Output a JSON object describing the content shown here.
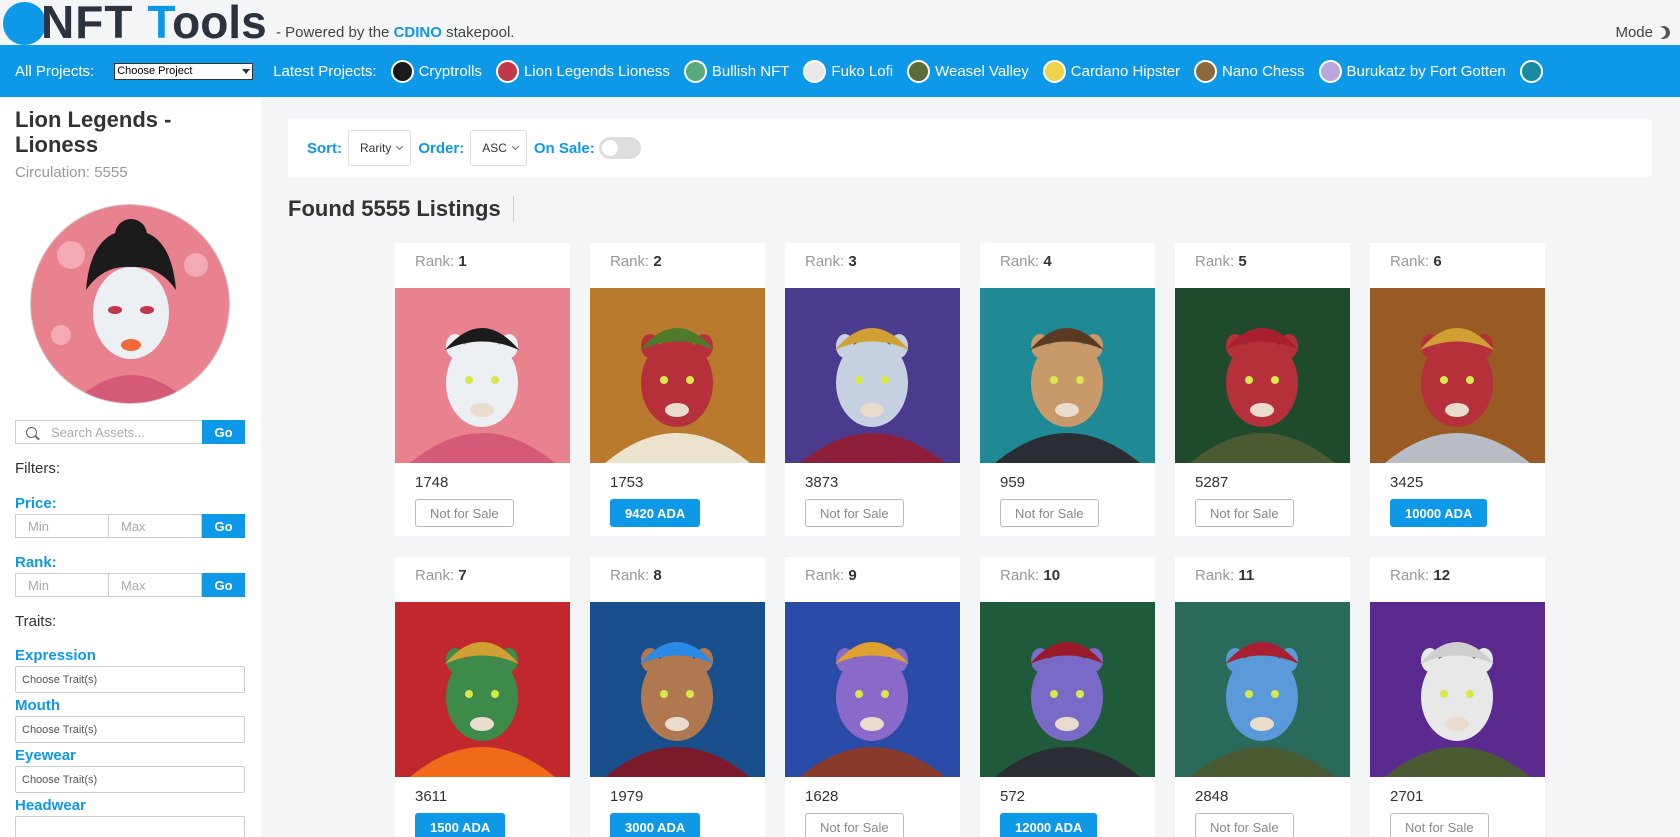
{
  "header": {
    "logo_nft": "NFT",
    "logo_tools_1": "T",
    "logo_tools_2": "ools",
    "powered_prefix": "- Powered by the",
    "powered_brand": "CDINO",
    "powered_suffix": "stakepool.",
    "mode_label": "Mode",
    "brand_color": "#0d98e8"
  },
  "projbar": {
    "all_projects_label": "All Projects:",
    "select_value": "Choose Project",
    "latest_label": "Latest Projects:",
    "projects": [
      {
        "name": "Cryptrolls",
        "color": "#1a1a1a"
      },
      {
        "name": "Lion Legends Lioness",
        "color": "#c0384a"
      },
      {
        "name": "Bullish NFT",
        "color": "#5aa97a"
      },
      {
        "name": "Fuko Lofi",
        "color": "#e8e8e8"
      },
      {
        "name": "Weasel Valley",
        "color": "#5c6b3a"
      },
      {
        "name": "Cardano Hipster",
        "color": "#f0d34a"
      },
      {
        "name": "Nano Chess",
        "color": "#8a6a3a"
      },
      {
        "name": "Burukatz by Fort Gotten",
        "color": "#b8a6e0"
      }
    ]
  },
  "sidebar": {
    "title": "Lion Legends - Lioness",
    "circulation": "Circulation: 5555",
    "search_placeholder": "Search Assets...",
    "go": "Go",
    "filters_label": "Filters:",
    "price_label": "Price:",
    "rank_label": "Rank:",
    "min": "Min",
    "max": "Max",
    "traits_label": "Traits:",
    "traits": [
      {
        "name": "Expression",
        "placeholder": "Choose Trait(s)"
      },
      {
        "name": "Mouth",
        "placeholder": "Choose Trait(s)"
      },
      {
        "name": "Eyewear",
        "placeholder": "Choose Trait(s)"
      },
      {
        "name": "Headwear",
        "placeholder": ""
      }
    ]
  },
  "filterbar": {
    "sort_label": "Sort:",
    "sort_value": "Rarity",
    "order_label": "Order:",
    "order_value": "ASC",
    "onsale_label": "On Sale:"
  },
  "found": "Found 5555 Listings",
  "cards": [
    {
      "rank_label": "Rank:",
      "rank": "1",
      "id": "1748",
      "price": "Not for Sale",
      "on_sale": false,
      "bg": "#e9828f",
      "skin": "#eceff3",
      "hat": "#1b1b1b",
      "cloth": "#d45a78"
    },
    {
      "rank_label": "Rank:",
      "rank": "2",
      "id": "1753",
      "price": "9420 ADA",
      "on_sale": true,
      "bg": "#b97a2d",
      "skin": "#b5303a",
      "hat": "#4f7a2a",
      "cloth": "#ece3cf"
    },
    {
      "rank_label": "Rank:",
      "rank": "3",
      "id": "3873",
      "price": "Not for Sale",
      "on_sale": false,
      "bg": "#4a3b8e",
      "skin": "#c5d0e0",
      "hat": "#d1a032",
      "cloth": "#8e1f3a"
    },
    {
      "rank_label": "Rank:",
      "rank": "4",
      "id": "959",
      "price": "Not for Sale",
      "on_sale": false,
      "bg": "#1f8a95",
      "skin": "#c89a6a",
      "hat": "#5a3a22",
      "cloth": "#2a2d34"
    },
    {
      "rank_label": "Rank:",
      "rank": "5",
      "id": "5287",
      "price": "Not for Sale",
      "on_sale": false,
      "bg": "#1f4a2c",
      "skin": "#b5303a",
      "hat": "#a82030",
      "cloth": "#4a5a32"
    },
    {
      "rank_label": "Rank:",
      "rank": "6",
      "id": "3425",
      "price": "10000 ADA",
      "on_sale": true,
      "bg": "#9a5a24",
      "skin": "#b5303a",
      "hat": "#d1a032",
      "cloth": "#b8bcc4"
    },
    {
      "rank_label": "Rank:",
      "rank": "7",
      "id": "3611",
      "price": "1500 ADA",
      "on_sale": true,
      "bg": "#c0282e",
      "skin": "#3d8a4a",
      "hat": "#d1a032",
      "cloth": "#f06a1a"
    },
    {
      "rank_label": "Rank:",
      "rank": "8",
      "id": "1979",
      "price": "3000 ADA",
      "on_sale": true,
      "bg": "#1a4f8e",
      "skin": "#b07850",
      "hat": "#2a8ae8",
      "cloth": "#7a1a2a"
    },
    {
      "rank_label": "Rank:",
      "rank": "9",
      "id": "1628",
      "price": "Not for Sale",
      "on_sale": false,
      "bg": "#2a4aa8",
      "skin": "#8a6ac8",
      "hat": "#e0a030",
      "cloth": "#8a3a2a"
    },
    {
      "rank_label": "Rank:",
      "rank": "10",
      "id": "572",
      "price": "12000 ADA",
      "on_sale": true,
      "bg": "#1f5a3a",
      "skin": "#7a6ac8",
      "hat": "#9a1a2a",
      "cloth": "#2a2d34"
    },
    {
      "rank_label": "Rank:",
      "rank": "11",
      "id": "2848",
      "price": "Not for Sale",
      "on_sale": false,
      "bg": "#2a6a5a",
      "skin": "#5a9ad8",
      "hat": "#a82030",
      "cloth": "#4a5a32"
    },
    {
      "rank_label": "Rank:",
      "rank": "12",
      "id": "2701",
      "price": "Not for Sale",
      "on_sale": false,
      "bg": "#5a2a8e",
      "skin": "#e8e8e8",
      "hat": "#cfcfcf",
      "cloth": "#4a5a32"
    }
  ]
}
